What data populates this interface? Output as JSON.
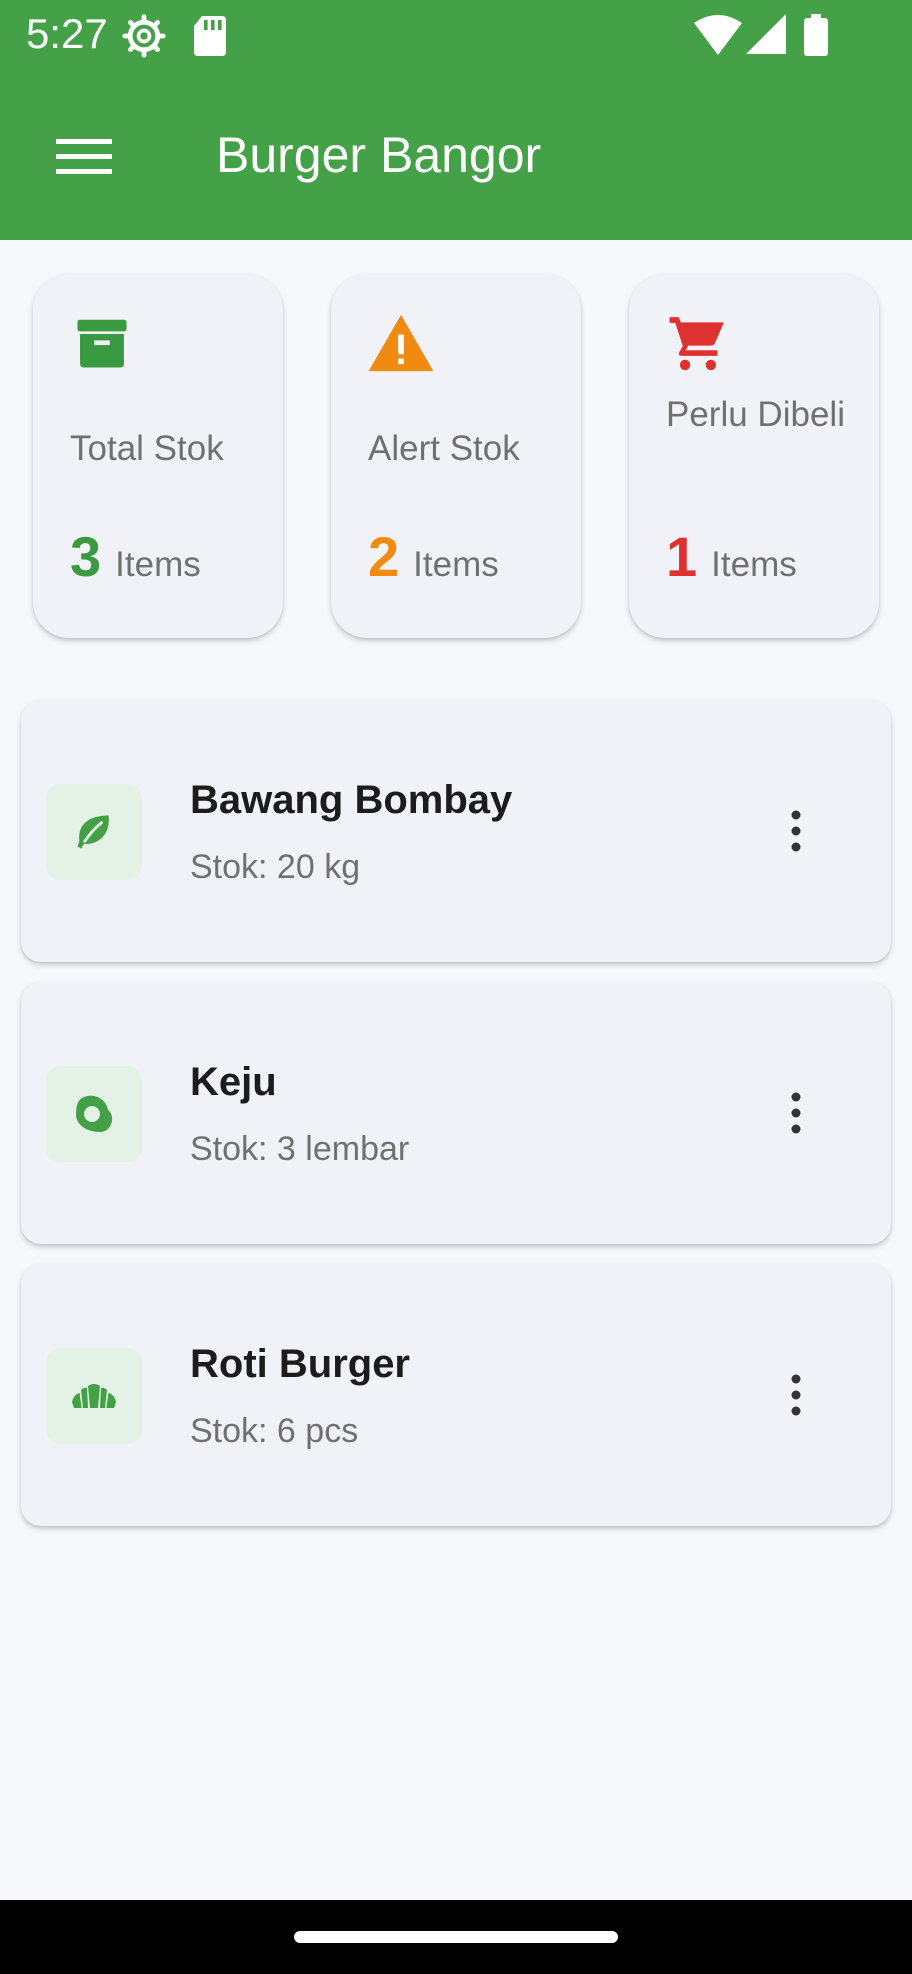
{
  "status_bar": {
    "time": "5:27",
    "icons": [
      "settings-icon",
      "sd-card-icon",
      "wifi-icon",
      "signal-icon",
      "battery-icon"
    ]
  },
  "app_bar": {
    "title": "Burger Bangor",
    "menu_icon": "hamburger-menu-icon",
    "color": "#45a148"
  },
  "summary": [
    {
      "icon": "archive-box-icon",
      "label": "Total Stok",
      "value": "3",
      "unit": "Items",
      "color": "#3a9a3f"
    },
    {
      "icon": "warning-icon",
      "label": "Alert Stok",
      "value": "2",
      "unit": "Items",
      "color": "#f08a10"
    },
    {
      "icon": "cart-icon",
      "label": "Perlu Dibeli",
      "value": "1",
      "unit": "Items",
      "color": "#e03131"
    }
  ],
  "items": [
    {
      "icon": "leaf-icon",
      "name": "Bawang Bombay",
      "stock": "Stok: 20 kg"
    },
    {
      "icon": "cheese-egg-icon",
      "name": "Keju",
      "stock": "Stok: 3 lembar"
    },
    {
      "icon": "bread-icon",
      "name": "Roti Burger",
      "stock": "Stok: 6 pcs"
    }
  ]
}
